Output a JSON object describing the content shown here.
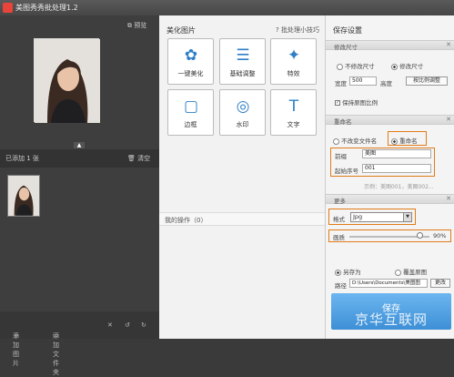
{
  "app": {
    "title": "美图秀秀批处理1.2"
  },
  "left": {
    "preview_label": "预览",
    "added_label": "已添加 1 张",
    "clear_label": "清空",
    "add_image_label": "添加图片",
    "add_folder_label": "添加文件夹"
  },
  "middle": {
    "heading": "美化图片",
    "tips": "批处理小技巧",
    "tiles": [
      {
        "label": "一键美化",
        "icon": "beautify-icon"
      },
      {
        "label": "基础调整",
        "icon": "adjust-sliders-icon"
      },
      {
        "label": "特效",
        "icon": "magic-wand-icon"
      },
      {
        "label": "边框",
        "icon": "frame-icon"
      },
      {
        "label": "水印",
        "icon": "watermark-icon"
      },
      {
        "label": "文字",
        "icon": "text-icon"
      }
    ],
    "ops_label": "我的操作（0）"
  },
  "right": {
    "title": "保存设置",
    "resize": {
      "section": "修改尺寸",
      "opt_keep": "不修改尺寸",
      "opt_change": "修改尺寸",
      "width_label": "宽度",
      "width_value": "500",
      "height_label": "高度",
      "ratio_btn": "按比例调整",
      "keep_ratio": "保持原图比例"
    },
    "rename": {
      "section": "重命名",
      "opt_keep": "不改变文件名",
      "opt_rename": "重命名",
      "prefix_label": "前缀",
      "prefix_value": "美图",
      "start_label": "起始序号",
      "start_value": "001",
      "example": "示例：美图001，美图002..."
    },
    "more": {
      "section": "更多",
      "format_label": "格式",
      "format_value": "Jpg",
      "quality_label": "画质",
      "quality_value": "90%",
      "quality_fraction": 0.88
    },
    "output": {
      "opt_saveas": "另存为",
      "opt_overwrite": "覆盖原图",
      "path_label": "路径",
      "path_value": "D:\\Users\\Documents\\美图图",
      "change_btn": "更改",
      "save_btn": "保存"
    }
  },
  "watermark": "京华互联网"
}
